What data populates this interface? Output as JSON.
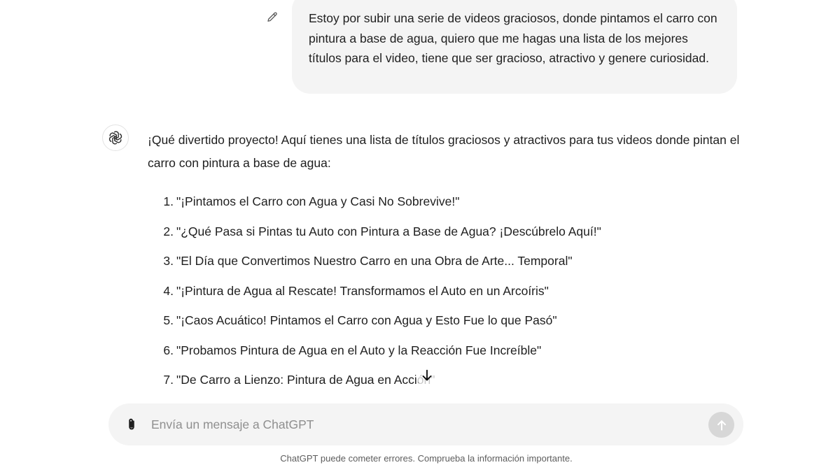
{
  "user_message": {
    "text": "Estoy por subir una serie de videos graciosos, donde pintamos el carro con pintura a base de agua, quiero que me hagas una lista de los mejores títulos para el video, tiene que ser gracioso, atractivo y genere curiosidad."
  },
  "assistant_message": {
    "intro": "¡Qué divertido proyecto! Aquí tienes una lista de títulos graciosos y atractivos para tus videos donde pintan el carro con pintura a base de agua:",
    "titles": [
      {
        "num": "1",
        "text": "\"¡Pintamos el Carro con Agua y Casi No Sobrevive!\""
      },
      {
        "num": "2",
        "text": "\"¿Qué Pasa si Pintas tu Auto con Pintura a Base de Agua? ¡Descúbrelo Aquí!\""
      },
      {
        "num": "3",
        "text": "\"El Día que Convertimos Nuestro Carro en una Obra de Arte... Temporal\""
      },
      {
        "num": "4",
        "text": "\"¡Pintura de Agua al Rescate! Transformamos el Auto en un Arcoíris\""
      },
      {
        "num": "5",
        "text": "\"¡Caos Acuático! Pintamos el Carro con Agua y Esto Fue lo que Pasó\""
      },
      {
        "num": "6",
        "text": "\"Probamos Pintura de Agua en el Auto y la Reacción Fue Increíble\""
      },
      {
        "num": "7",
        "text": "\"De Carro a Lienzo: Pintura de Agua en Acción\""
      }
    ]
  },
  "composer": {
    "placeholder": "Envía un mensaje a ChatGPT",
    "value": ""
  },
  "disclaimer": "ChatGPT puede cometer errores. Comprueba la información importante.",
  "icons": {
    "edit": "pencil-icon",
    "avatar": "openai-logo-icon",
    "scroll": "arrow-down-icon",
    "attach": "paperclip-icon",
    "send": "arrow-up-icon"
  },
  "colors": {
    "bubble_bg": "#f4f4f4",
    "composer_bg": "#f4f4f4",
    "send_disabled": "#d7d7d7",
    "text": "#1f1f1f",
    "placeholder": "#8f8f8f"
  }
}
